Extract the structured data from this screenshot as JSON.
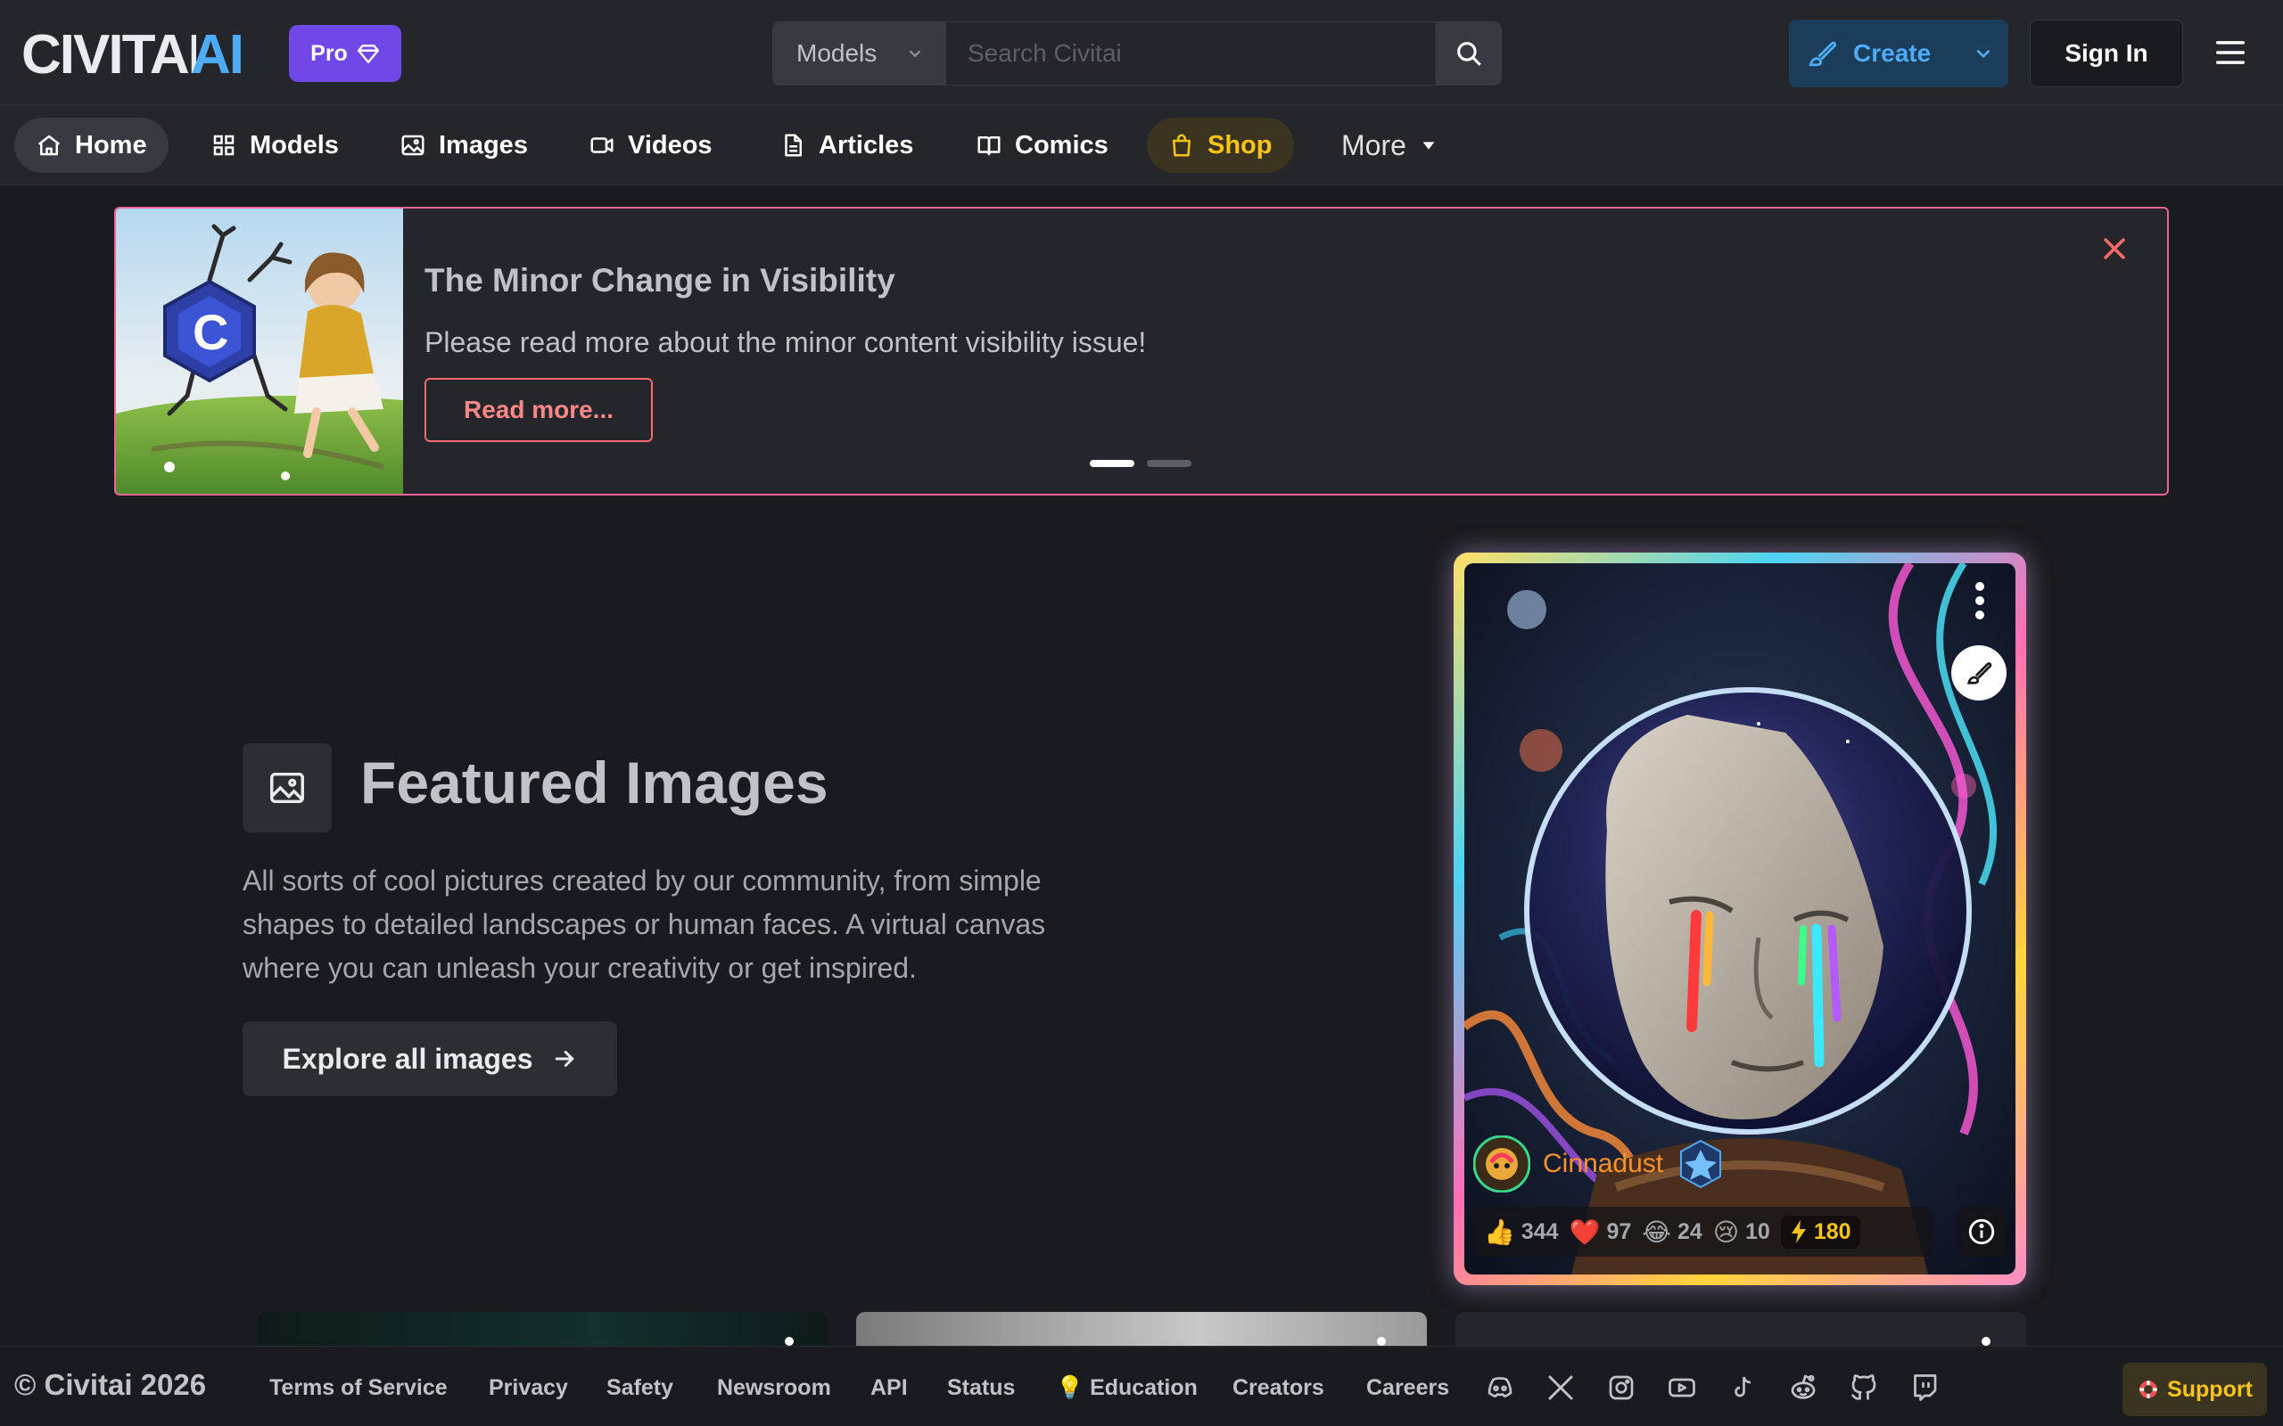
{
  "header": {
    "logo_text": "CIVITAI",
    "pro_label": "Pro",
    "search": {
      "type_label": "Models",
      "placeholder": "Search Civitai",
      "shortcut": "/"
    },
    "create_label": "Create",
    "signin_label": "Sign In"
  },
  "nav": {
    "items": [
      {
        "label": "Home",
        "icon": "home-icon"
      },
      {
        "label": "Models",
        "icon": "grid-icon"
      },
      {
        "label": "Images",
        "icon": "image-icon"
      },
      {
        "label": "Videos",
        "icon": "video-icon"
      },
      {
        "label": "Articles",
        "icon": "document-icon"
      },
      {
        "label": "Comics",
        "icon": "book-icon"
      },
      {
        "label": "Shop",
        "icon": "shopping-bag-icon"
      }
    ],
    "more_label": "More"
  },
  "announcement": {
    "title": "The Minor Change in Visibility",
    "text": "Please read more about the minor content visibility issue!",
    "button": "Read more...",
    "slides": 2,
    "active_slide": 1,
    "border_color": "#f06595"
  },
  "featured": {
    "title": "Featured Images",
    "description": "All sorts of cool pictures created by our community, from simple shapes to detailed landscapes or human faces. A virtual canvas where you can unleash your creativity or get inspired.",
    "button": "Explore all images",
    "card": {
      "username": "Cinnadust",
      "reactions": [
        {
          "emoji": "👍",
          "count": "344"
        },
        {
          "emoji": "❤️",
          "count": "97"
        },
        {
          "emoji": "😂",
          "count": "24"
        },
        {
          "emoji": "😢",
          "count": "10"
        }
      ],
      "buzz": "180"
    }
  },
  "footer": {
    "copyright": "© Civitai 2026",
    "links": [
      "Terms of Service",
      "Privacy",
      "Safety",
      "Newsroom",
      "API",
      "Status",
      "💡 Education",
      "Creators",
      "Careers"
    ],
    "social_icons": [
      "discord-icon",
      "x-icon",
      "instagram-icon",
      "youtube-icon",
      "tiktok-icon",
      "reddit-icon",
      "github-icon",
      "twitch-icon"
    ],
    "support_label": "Support"
  },
  "colors": {
    "background": "#1a1b1e",
    "surface": "#25262b",
    "pro": "#7048e8",
    "create": "#4dabf7",
    "shop": "#fcc419",
    "accent_red": "#ff6b6b"
  }
}
